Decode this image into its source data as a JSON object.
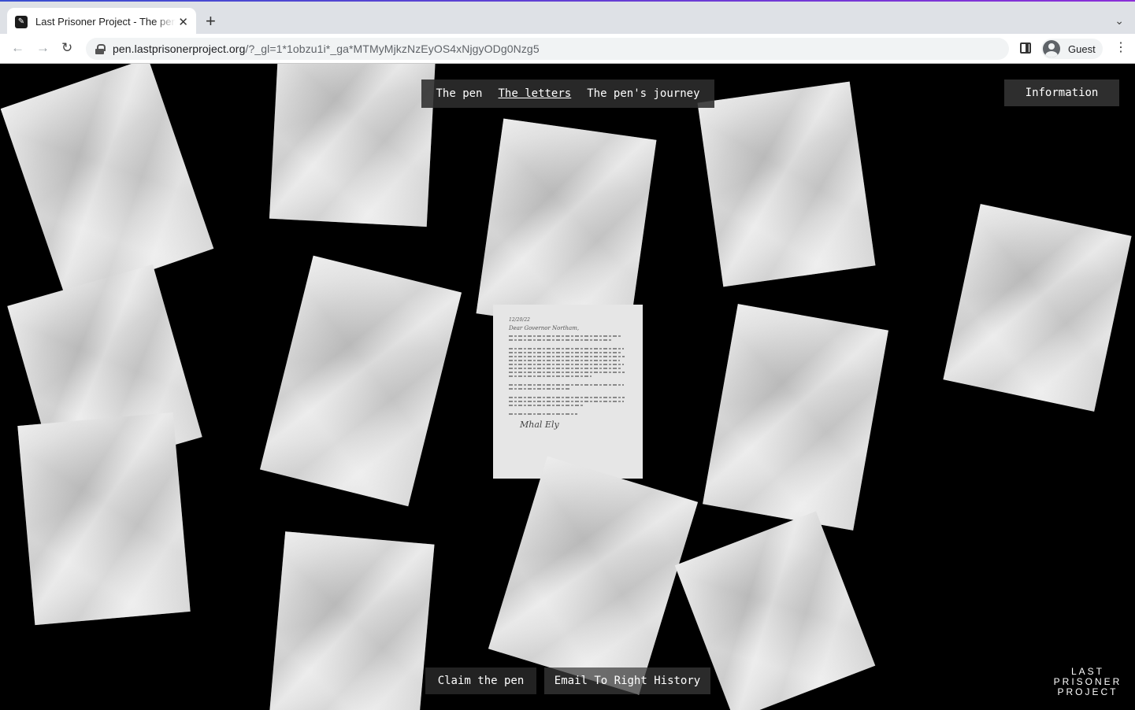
{
  "browser": {
    "tab_title": "Last Prisoner Project - The pen",
    "tab_close": "✕",
    "new_tab": "+",
    "tab_menu": "⌄",
    "url_host": "pen.lastprisonerproject.org",
    "url_path": "/?_gl=1*1obzu1i*_ga*MTMyMjkzNzEyOS4xNjgyODg0Nzg5",
    "back": "←",
    "forward": "→",
    "reload": "↻",
    "profile_label": "Guest",
    "menu": "⋮"
  },
  "nav": {
    "items": [
      {
        "label": "The pen"
      },
      {
        "label": "The letters"
      },
      {
        "label": "The pen's journey"
      }
    ],
    "active": "The letters"
  },
  "information_label": "Information",
  "actions": {
    "claim_label": "Claim the pen",
    "email_label": "Email To Right History"
  },
  "logo": {
    "line1": "LAST",
    "line2": "PRISONER",
    "line3": "PROJECT"
  },
  "letter": {
    "date": "12/20/22",
    "salutation": "Dear Governor Northam,",
    "signature": "Mhal Ely"
  }
}
